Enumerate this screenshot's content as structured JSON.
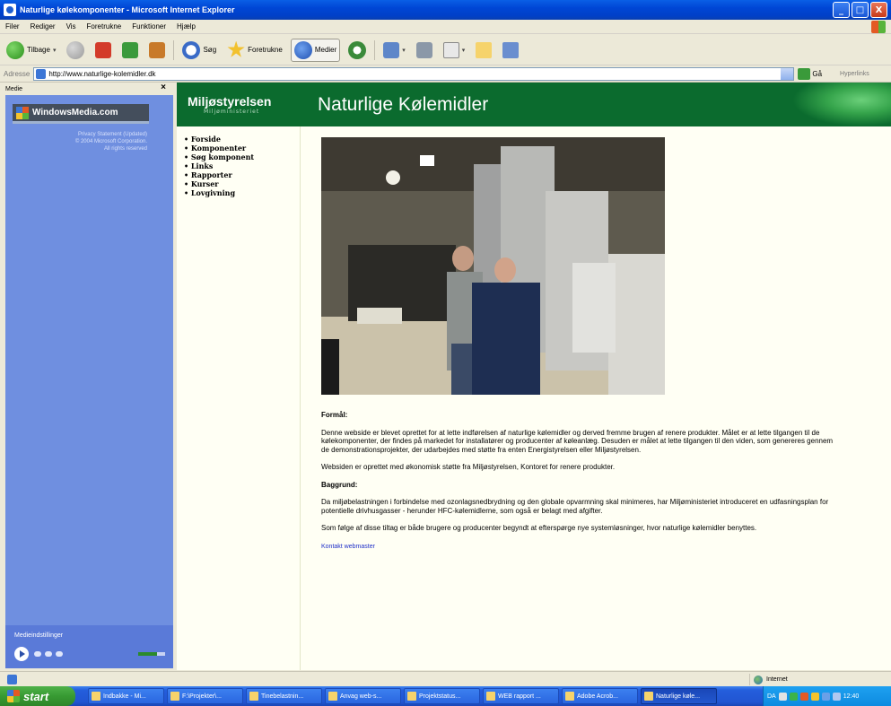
{
  "window": {
    "title": "Naturlige kølekomponenter - Microsoft Internet Explorer",
    "buttons": {
      "minimize": "_",
      "maximize": "□",
      "close": "X"
    }
  },
  "menu": [
    "Filer",
    "Rediger",
    "Vis",
    "Foretrukne",
    "Funktioner",
    "Hjælp"
  ],
  "toolbar": {
    "back_label": "Tilbage",
    "search_label": "Søg",
    "favorites_label": "Foretrukne",
    "media_label": "Medier"
  },
  "address": {
    "label": "Adresse",
    "url": "http://www.naturlige-kolemidler.dk",
    "go_label": "Gå",
    "links_label": "Hyperlinks"
  },
  "media_pane": {
    "title": "Medie",
    "close": "×",
    "logo_text": "WindowsMedia.com",
    "legal_lines": [
      "Privacy Statement (Updated)",
      "© 2004 Microsoft Corporation.",
      "All rights reserved"
    ],
    "options_label": "Medieindstillinger"
  },
  "site": {
    "org_name": "Miljøstyrelsen",
    "org_sub": "Miljøministeriet",
    "page_title": "Naturlige Kølemidler",
    "nav": [
      "Forside",
      "Komponenter",
      "Søg komponent",
      "Links",
      "Rapporter",
      "Kurser",
      "Lovgivning"
    ],
    "sections": [
      {
        "heading": "Formål:",
        "paragraphs": [
          "Denne webside er blevet oprettet for at lette indførelsen af naturlige kølemidler og derved fremme brugen af renere produkter. Målet er at lette tilgangen til de kølekomponenter, der findes på markedet for installatører og producenter af køleanlæg. Desuden er målet at lette tilgangen til den viden, som genereres gennem de demonstrationsprojekter, der udarbejdes med støtte fra enten Energistyrelsen eller Miljøstyrelsen.",
          "Websiden er oprettet med økonomisk støtte fra Miljøstyrelsen, Kontoret for renere produkter."
        ]
      },
      {
        "heading": "Baggrund:",
        "paragraphs": [
          "Da miljøbelastningen i forbindelse med ozonlagsnedbrydning og den globale opvarmning skal minimeres, har Miljøministeriet introduceret en udfasningsplan for potentielle drivhusgasser - herunder HFC-kølemidlerne, som også er belagt med afgifter.",
          "Som følge af disse tiltag er både brugere og producenter begyndt at efterspørge nye systemløsninger, hvor naturlige kølemidler benyttes."
        ]
      }
    ],
    "contact_link": "Kontakt webmaster"
  },
  "statusbar": {
    "zone": "Internet"
  },
  "taskbar": {
    "start_label": "start",
    "tasks": [
      "Indbakke - Mi...",
      "F:\\Projekter\\...",
      "Tinebelastnin...",
      "Anvag web-s...",
      "Projektstatus...",
      "WEB rapport ...",
      "Adobe Acrob...",
      "Naturlige køle..."
    ],
    "active_task": 7,
    "tray_lang": "DA",
    "clock": "12:40"
  }
}
